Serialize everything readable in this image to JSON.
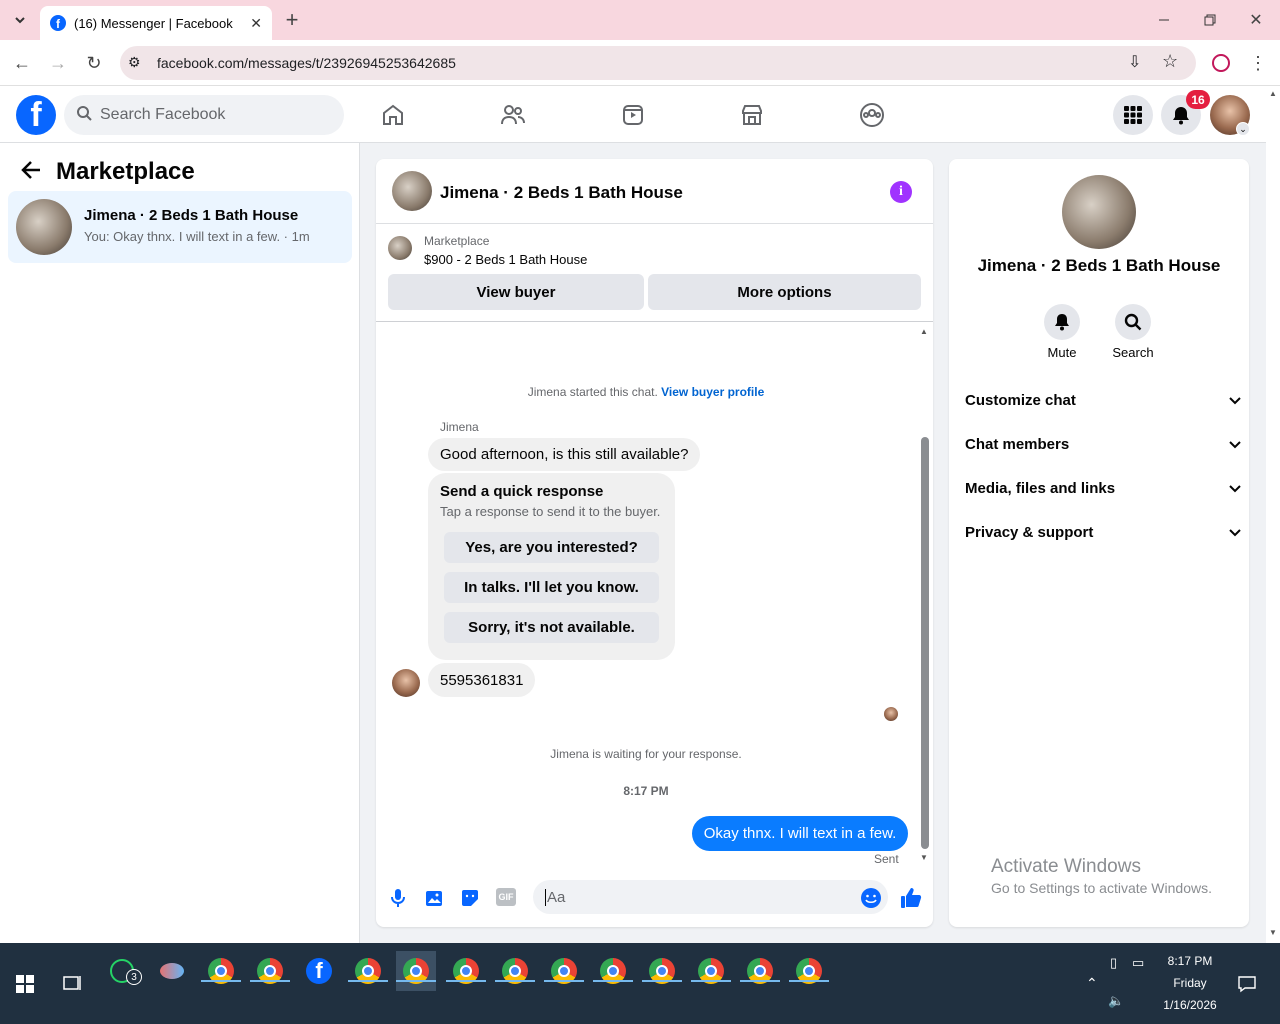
{
  "browser": {
    "tab_title": "(16) Messenger | Facebook",
    "url": "facebook.com/messages/t/23926945253642685"
  },
  "fb_header": {
    "search_placeholder": "Search Facebook",
    "notifications_count": "16"
  },
  "left_panel": {
    "title": "Marketplace",
    "conversation": {
      "name": "Jimena · 2 Beds 1 Bath House",
      "preview": "You: Okay thnx. I will text in a few. · 1m"
    }
  },
  "chat": {
    "header_title": "Jimena · 2 Beds 1 Bath House",
    "marketplace_label": "Marketplace",
    "listing": "$900 - 2 Beds 1 Bath House",
    "view_buyer": "View buyer",
    "more_options": "More options",
    "started_text": "Jimena started this chat.",
    "view_buyer_profile": "View buyer profile",
    "sender_name": "Jimena",
    "msg1": "Good afternoon, is this still available?",
    "quick_title": "Send a quick response",
    "quick_sub": "Tap a response to send it to the buyer.",
    "quick_options": [
      "Yes, are you interested?",
      "In talks. I'll let you know.",
      "Sorry, it's not available."
    ],
    "msg2": "5595361831",
    "waiting_text": "Jimena is waiting for your response.",
    "time": "8:17 PM",
    "my_msg": "Okay thnx. I will text in a few.",
    "sent_label": "Sent",
    "composer_placeholder": "Aa"
  },
  "right_panel": {
    "name": "Jimena · 2 Beds 1 Bath House",
    "mute_label": "Mute",
    "search_label": "Search",
    "rows": [
      "Customize chat",
      "Chat members",
      "Media, files and links",
      "Privacy & support"
    ],
    "activate_title": "Activate Windows",
    "activate_sub": "Go to Settings to activate Windows."
  },
  "taskbar": {
    "whatsapp_badge": "3",
    "time": "8:17 PM",
    "day": "Friday",
    "date": "1/16/2026"
  },
  "colors": {
    "fb_blue": "#0866ff",
    "message_blue": "#0a7cff",
    "info_purple": "#a033ff",
    "badge_red": "#e41e3f"
  }
}
